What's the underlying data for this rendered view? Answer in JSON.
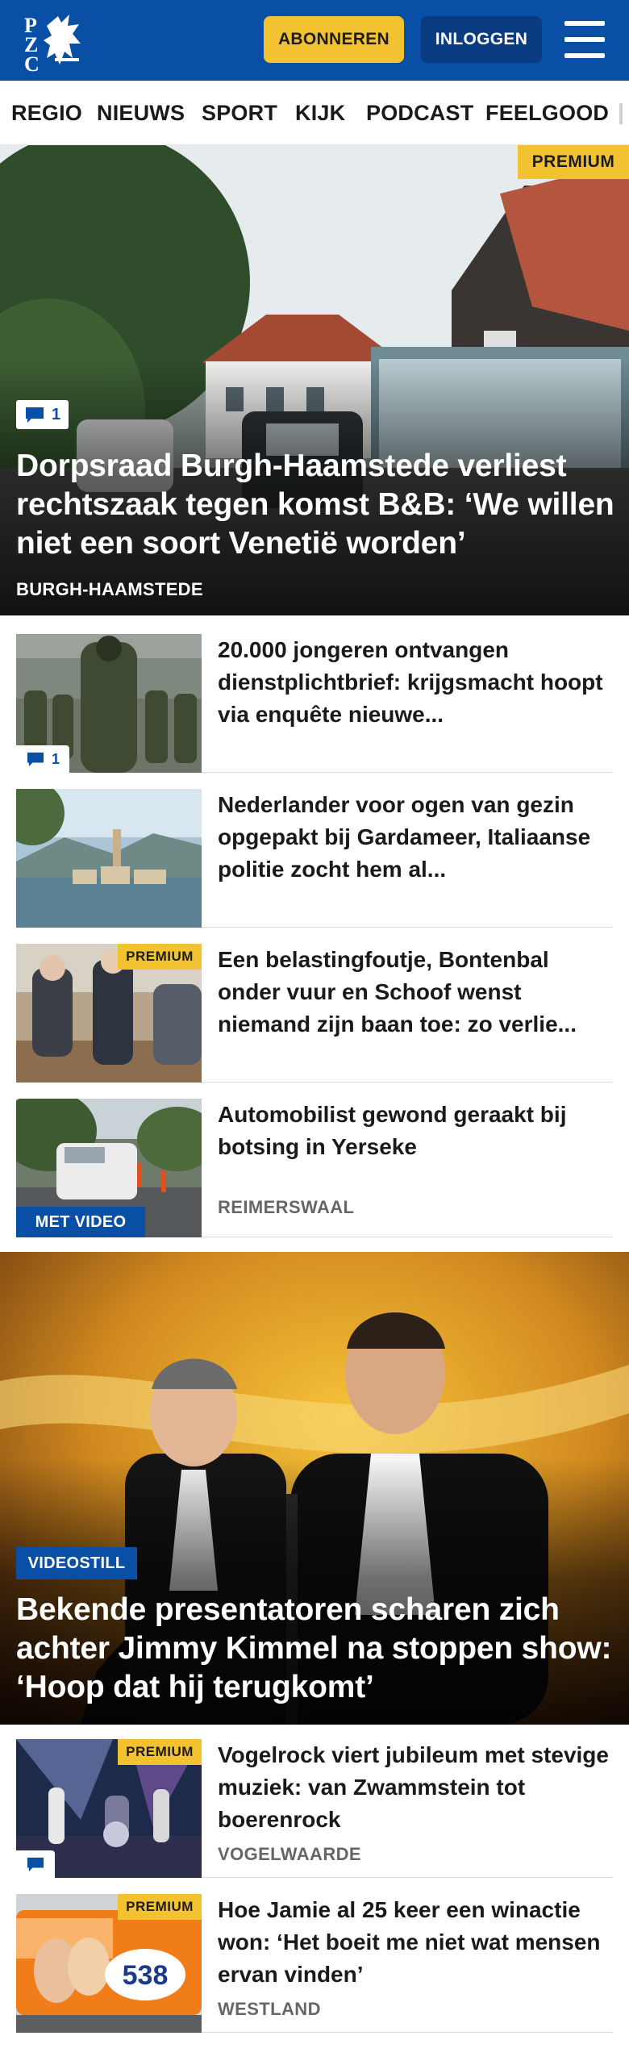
{
  "brand": {
    "logo_text": "PZC",
    "colors": {
      "primary": "#0a4fa6",
      "accent": "#f3c230"
    }
  },
  "header": {
    "subscribe_label": "ABONNEREN",
    "login_label": "INLOGGEN",
    "menu_icon": "hamburger-menu-icon"
  },
  "nav": {
    "items": [
      "REGIO",
      "NIEUWS",
      "SPORT",
      "KIJK",
      "PODCAST",
      "FEELGOOD"
    ]
  },
  "hero": {
    "badge": "PREMIUM",
    "comments": "1",
    "title": "Dorpsraad Burgh-Haamstede verliest rechtszaak tegen komst B&B: ‘We willen niet een soort Venetië worden’",
    "location": "BURGH-HAAMSTEDE"
  },
  "articles": [
    {
      "title": "20.000 jongeren ontvangen dienstplichtbrief: krijgsmacht hoopt via enquête nieuwe...",
      "comments": "1"
    },
    {
      "title": "Nederlander voor ogen van gezin opgepakt bij Gardameer, Italiaanse politie zocht hem al..."
    },
    {
      "title": "Een belastingfoutje, Bontenbal onder vuur en Schoof wenst niemand zijn baan toe: zo verlie...",
      "badge": "PREMIUM"
    },
    {
      "title": "Automobilist gewond geraakt bij botsing in Yerseke",
      "location": "REIMERSWAAL",
      "video_badge": "MET VIDEO"
    }
  ],
  "hero2": {
    "badge": "VIDEOSTILL",
    "title": "Bekende presentatoren scharen zich achter Jimmy Kimmel na stoppen show: ‘Hoop dat hij terugkomt’"
  },
  "articles2": [
    {
      "title": "Vogelrock viert jubileum met stevige muziek: van Zwammstein tot boerenrock",
      "location": "VOGELWAARDE",
      "badge": "PREMIUM"
    },
    {
      "title": "Hoe Jamie al 25 keer een winactie won: ‘Het boeit me niet wat mensen ervan vinden’",
      "location": "WESTLAND",
      "badge": "PREMIUM",
      "bus_text": "538"
    }
  ]
}
